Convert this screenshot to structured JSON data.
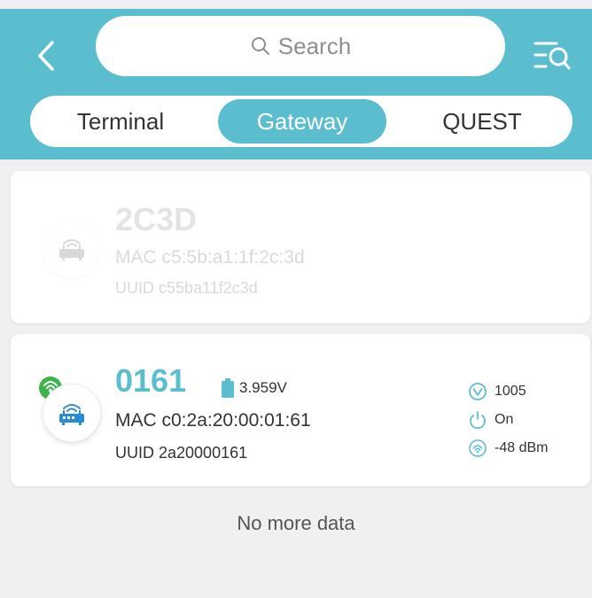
{
  "header": {
    "search_placeholder": "Search"
  },
  "tabs": [
    {
      "label": "Terminal",
      "active": false
    },
    {
      "label": "Gateway",
      "active": true
    },
    {
      "label": "QUEST",
      "active": false
    }
  ],
  "devices": [
    {
      "name": "2C3D",
      "mac": "MAC c5:5b:a1:1f:2c:3d",
      "uuid": "UUID c55ba11f2c3d",
      "online": false
    },
    {
      "name": "0161",
      "battery": "3.959V",
      "mac": "MAC c0:2a:20:00:01:61",
      "uuid": "UUID 2a20000161",
      "version": "1005",
      "power": "On",
      "rssi": "-48 dBm",
      "online": true
    }
  ],
  "footer": {
    "no_more": "No more data"
  },
  "colors": {
    "accent": "#5bbecf",
    "online_green": "#3bb54a",
    "router_blue": "#2b8cd6"
  }
}
